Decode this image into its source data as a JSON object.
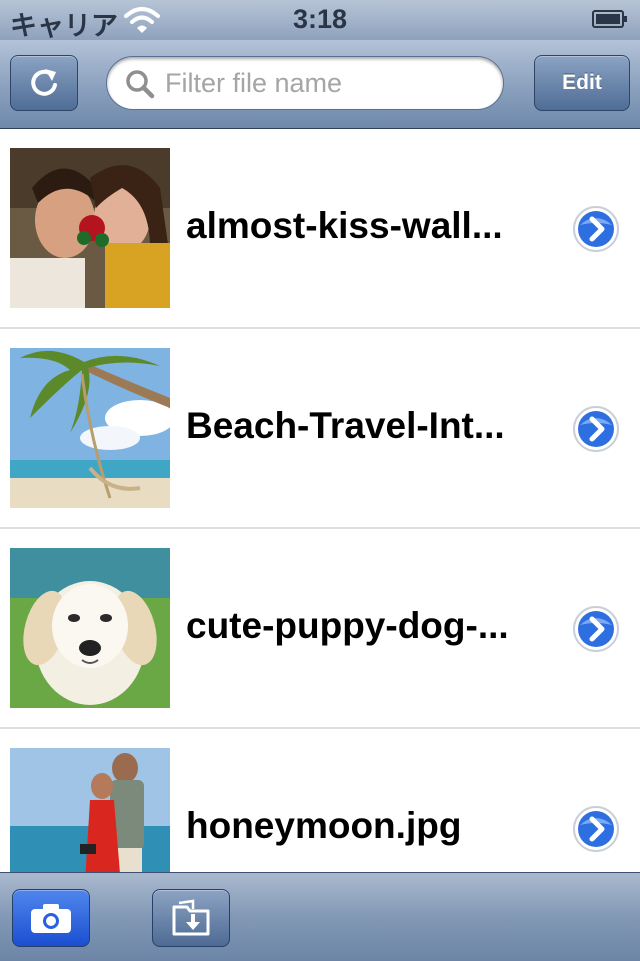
{
  "status_bar": {
    "carrier": "キャリア",
    "time": "3:18",
    "icons": [
      "wifi-icon",
      "battery-icon"
    ]
  },
  "nav_bar": {
    "refresh_icon": "refresh-icon",
    "search_placeholder": "Filter file name",
    "search_value": "",
    "edit_label": "Edit"
  },
  "files": [
    {
      "name": "almost-kiss-wall...",
      "thumbnail": "couple-with-rose-photo"
    },
    {
      "name": "Beach-Travel-Int...",
      "thumbnail": "palm-tree-hammock-beach-photo"
    },
    {
      "name": "cute-puppy-dog-...",
      "thumbnail": "white-puppy-photo"
    },
    {
      "name": "honeymoon.jpg",
      "thumbnail": "couple-on-beach-photo"
    }
  ],
  "toolbar": {
    "camera_icon": "camera-icon",
    "import_icon": "import-folder-icon",
    "camera_active_color": "#2a5fe0"
  },
  "colors": {
    "bar_blue": "#8aa0bd",
    "disclosure_blue": "#2d6fe0"
  }
}
